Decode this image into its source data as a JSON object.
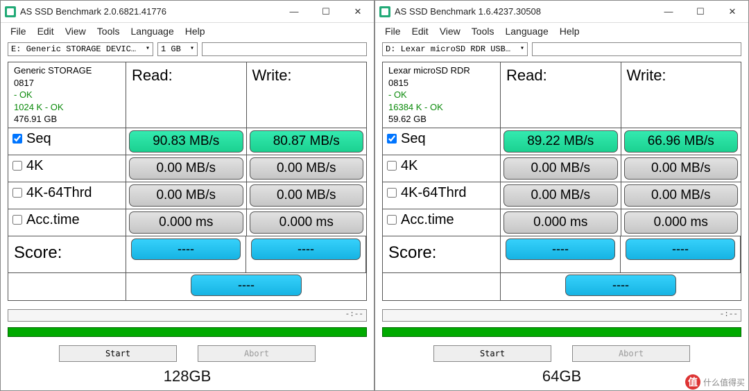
{
  "windows": [
    {
      "title": "AS SSD Benchmark 2.0.6821.41776",
      "menu": [
        "File",
        "Edit",
        "View",
        "Tools",
        "Language",
        "Help"
      ],
      "device": "E: Generic STORAGE DEVICE USB Dev",
      "size": "1 GB",
      "info": {
        "name": "Generic STORAGE",
        "model": "0817",
        "status": "- OK",
        "align": "1024 K - OK",
        "capacity": "476.91 GB"
      },
      "headers": {
        "read": "Read:",
        "write": "Write:"
      },
      "tests": [
        {
          "name": "Seq",
          "checked": true,
          "read": "90.83 MB/s",
          "write": "80.87 MB/s",
          "style": "green"
        },
        {
          "name": "4K",
          "checked": false,
          "read": "0.00 MB/s",
          "write": "0.00 MB/s",
          "style": "gray"
        },
        {
          "name": "4K-64Thrd",
          "checked": false,
          "read": "0.00 MB/s",
          "write": "0.00 MB/s",
          "style": "gray"
        },
        {
          "name": "Acc.time",
          "checked": false,
          "read": "0.000 ms",
          "write": "0.000 ms",
          "style": "gray"
        }
      ],
      "score_label": "Score:",
      "scores": {
        "read": "----",
        "write": "----",
        "total": "----"
      },
      "progress_text": "-:--",
      "buttons": {
        "start": "Start",
        "abort": "Abort"
      },
      "caption": "128GB"
    },
    {
      "title": "AS SSD Benchmark 1.6.4237.30508",
      "menu": [
        "File",
        "Edit",
        "View",
        "Tools",
        "Language",
        "Help"
      ],
      "device": "D: Lexar microSD RDR USB Device",
      "size": "",
      "info": {
        "name": "Lexar microSD RDR",
        "model": "0815",
        "status": "- OK",
        "align": "16384 K - OK",
        "capacity": "59.62 GB"
      },
      "headers": {
        "read": "Read:",
        "write": "Write:"
      },
      "tests": [
        {
          "name": "Seq",
          "checked": true,
          "read": "89.22 MB/s",
          "write": "66.96 MB/s",
          "style": "green"
        },
        {
          "name": "4K",
          "checked": false,
          "read": "0.00 MB/s",
          "write": "0.00 MB/s",
          "style": "gray"
        },
        {
          "name": "4K-64Thrd",
          "checked": false,
          "read": "0.00 MB/s",
          "write": "0.00 MB/s",
          "style": "gray"
        },
        {
          "name": "Acc.time",
          "checked": false,
          "read": "0.000 ms",
          "write": "0.000 ms",
          "style": "gray"
        }
      ],
      "score_label": "Score:",
      "scores": {
        "read": "----",
        "write": "----",
        "total": "----"
      },
      "progress_text": "-:--",
      "buttons": {
        "start": "Start",
        "abort": "Abort"
      },
      "caption": "64GB"
    }
  ],
  "watermark": {
    "glyph": "值",
    "text": "什么值得买"
  }
}
